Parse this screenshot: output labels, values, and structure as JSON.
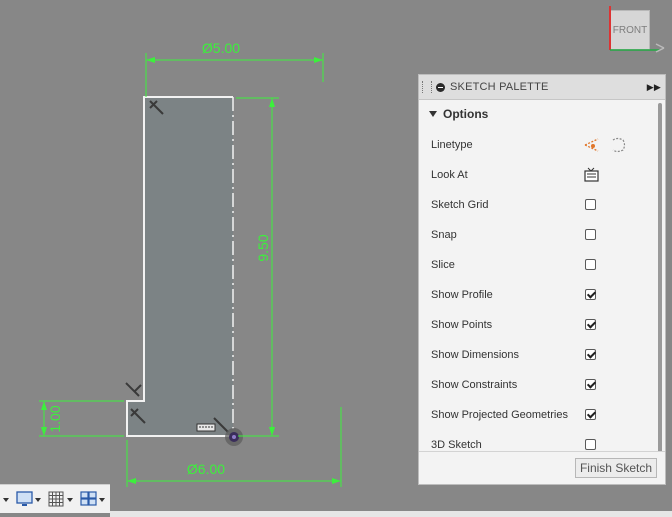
{
  "sketch": {
    "dim_top": "Ø5.00",
    "dim_height": "9.50",
    "dim_step": "1.00",
    "dim_bottom": "Ø6.00"
  },
  "viewcube": {
    "label": "FRONT"
  },
  "palette": {
    "title": "SKETCH PALETTE",
    "section": "Options",
    "rows": [
      {
        "label": "Linetype",
        "type": "icons"
      },
      {
        "label": "Look At",
        "type": "icon"
      },
      {
        "label": "Sketch Grid",
        "checked": false
      },
      {
        "label": "Snap",
        "checked": false
      },
      {
        "label": "Slice",
        "checked": false
      },
      {
        "label": "Show Profile",
        "checked": true
      },
      {
        "label": "Show Points",
        "checked": true
      },
      {
        "label": "Show Dimensions",
        "checked": true
      },
      {
        "label": "Show Constraints",
        "checked": true
      },
      {
        "label": "Show Projected Geometries",
        "checked": true
      },
      {
        "label": "3D Sketch",
        "checked": false
      }
    ],
    "finish_label": "Finish Sketch"
  },
  "toolbar": {
    "items": [
      "display-settings-icon",
      "grid-settings-icon",
      "viewports-icon"
    ]
  },
  "colors": {
    "background": "#878787",
    "dimension": "#3cf03c",
    "profile_fill": "#7c8385",
    "sketch_line": "#f2f2f2"
  }
}
